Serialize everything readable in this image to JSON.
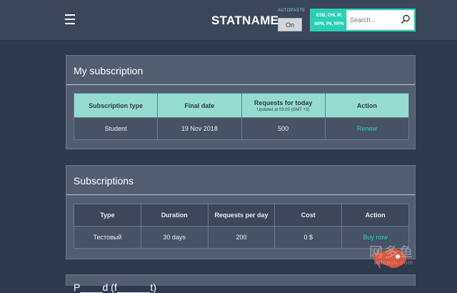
{
  "header": {
    "brand": "STATNAME",
    "autopaste_label": "AUTOPASTE",
    "autopaste_value": "On",
    "search_types": [
      "ESB, CHI, IP,",
      "MPN, P6, WPN"
    ],
    "search_placeholder": "Search..."
  },
  "my_subscription": {
    "title": "My subscription",
    "columns": [
      "Subscription type",
      "Final date",
      "Requests for today",
      "Action"
    ],
    "requests_note": "Updated at 03:00 (GMT +3)",
    "row": [
      "Student",
      "19 Nov 2018",
      "500",
      "Renew"
    ]
  },
  "subscriptions": {
    "title": "Subscriptions",
    "columns": [
      "Type",
      "Duration",
      "Requests per day",
      "Cost",
      "Action"
    ],
    "rows": [
      [
        "Тестовый",
        "30 days",
        "200",
        "0 $",
        "Buy now"
      ]
    ]
  },
  "third_panel": {
    "title": "P____d (f______t)"
  },
  "watermark": {
    "text": "网多鱼",
    "sub": "wduoyu.com"
  },
  "colors": {
    "accent": "#2bd0b3",
    "header_cell": "#95dccf",
    "panel": "#535e71",
    "background": "#2e3a4e"
  }
}
